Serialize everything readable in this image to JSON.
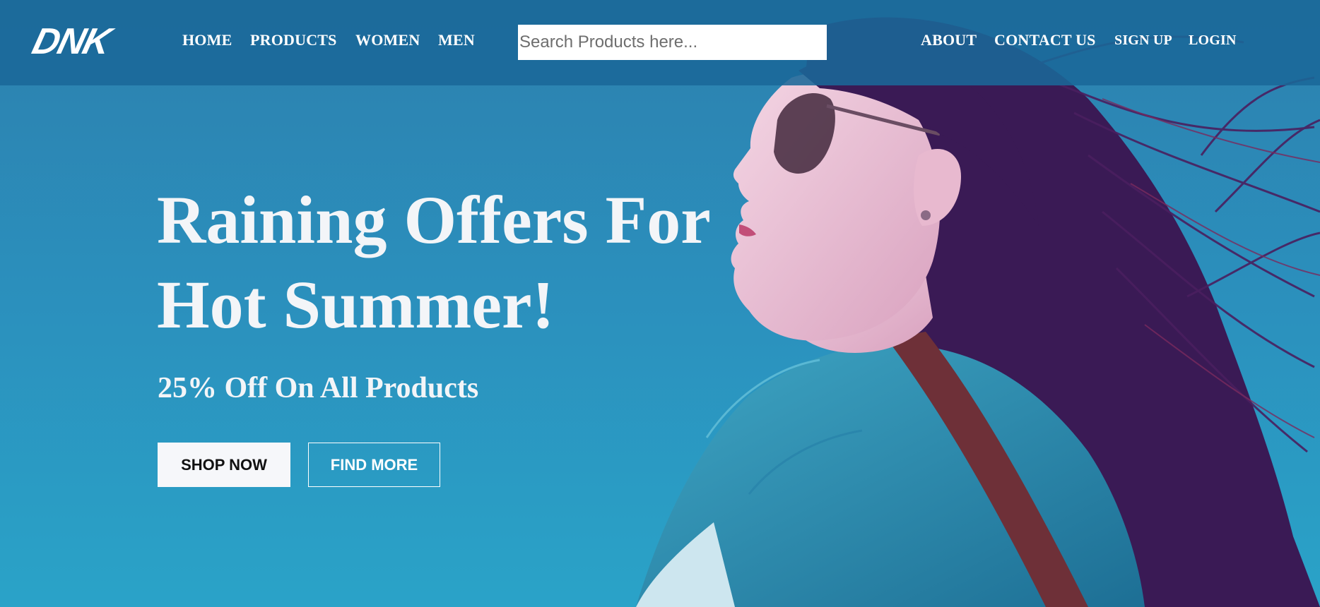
{
  "brand": {
    "logo_text": "DNK"
  },
  "nav": {
    "left": [
      "HOME",
      "PRODUCTS",
      "WOMEN",
      "MEN"
    ],
    "right": [
      "ABOUT",
      "CONTACT US",
      "SIGN UP",
      "LOGIN"
    ]
  },
  "search": {
    "placeholder": "Search Products here...",
    "value": ""
  },
  "hero": {
    "title_line1": "Raining Offers For",
    "title_line2": "Hot Summer!",
    "subtitle": "25% Off On All Products",
    "primary_button": "SHOP NOW",
    "secondary_button": "FIND MORE"
  },
  "colors": {
    "header_bg": "#1a6898",
    "sky": "#2b8dbb",
    "text_light": "#f3f5f8",
    "button_bg": "#f6f7fa"
  }
}
